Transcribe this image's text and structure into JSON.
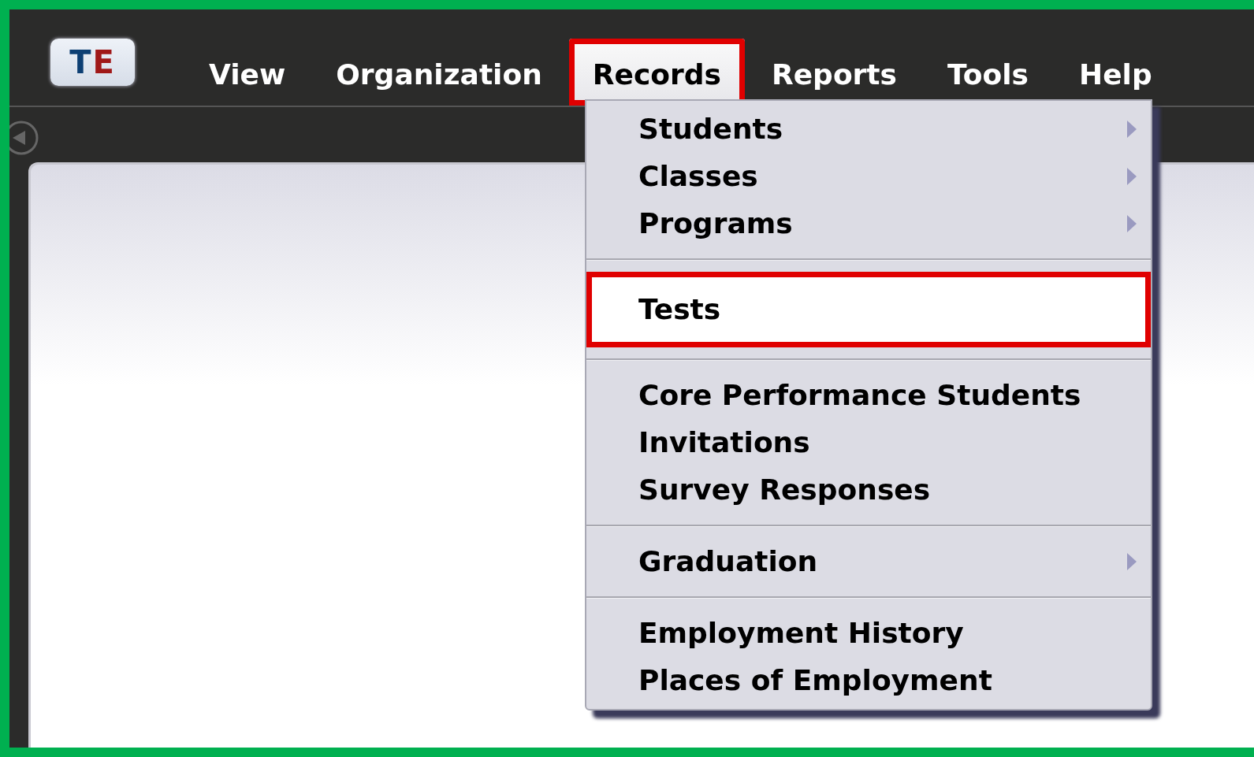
{
  "logo": {
    "text_1": "T",
    "text_2": "E"
  },
  "nav": [
    {
      "label": "View",
      "selected": false,
      "annotated": false
    },
    {
      "label": "Organization",
      "selected": false,
      "annotated": false
    },
    {
      "label": "Records",
      "selected": true,
      "annotated": true
    },
    {
      "label": "Reports",
      "selected": false,
      "annotated": false
    },
    {
      "label": "Tools",
      "selected": false,
      "annotated": false
    },
    {
      "label": "Help",
      "selected": false,
      "annotated": false
    }
  ],
  "menu": {
    "groups": [
      [
        {
          "label": "Students",
          "submenu": true,
          "selected": false,
          "annotated": false
        },
        {
          "label": "Classes",
          "submenu": true,
          "selected": false,
          "annotated": false
        },
        {
          "label": "Programs",
          "submenu": true,
          "selected": false,
          "annotated": false
        }
      ],
      [
        {
          "label": "Tests",
          "submenu": false,
          "selected": true,
          "annotated": true
        }
      ],
      [
        {
          "label": "Core Performance Students",
          "submenu": false,
          "selected": false,
          "annotated": false
        },
        {
          "label": "Invitations",
          "submenu": false,
          "selected": false,
          "annotated": false
        },
        {
          "label": "Survey Responses",
          "submenu": false,
          "selected": false,
          "annotated": false
        }
      ],
      [
        {
          "label": "Graduation",
          "submenu": true,
          "selected": false,
          "annotated": false
        }
      ],
      [
        {
          "label": "Employment History",
          "submenu": false,
          "selected": false,
          "annotated": false
        },
        {
          "label": "Places of Employment",
          "submenu": false,
          "selected": false,
          "annotated": false
        }
      ]
    ]
  }
}
